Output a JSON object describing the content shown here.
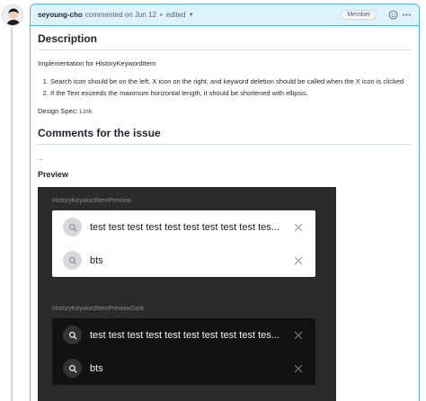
{
  "header": {
    "author": "seyoung-cho",
    "action": "commented on Jun 12",
    "separator": "•",
    "edited": "edited",
    "badge": "Member"
  },
  "description": {
    "title": "Description",
    "intro": "Implementation for HistoryKeywordItem",
    "items": [
      "Search icon should be on the left, X icon on the right, and keyword deletion should be called when the X icon is clicked",
      "If the Text exceeds the maximum horizontal length, it should be shortened with ellipsis."
    ],
    "design_spec_label": "Design Spec:",
    "design_spec_link": "Link"
  },
  "comments": {
    "title": "Comments for the issue",
    "body": "..."
  },
  "preview": {
    "title": "Preview",
    "light_label": "HistoryKeywordItemPreview",
    "dark_label": "HistoryKeywordItemPreviewDark",
    "keywords": [
      "test test test test test test test test test tes...",
      "bts"
    ]
  },
  "colors": {
    "accent": "#0969da",
    "header_bg": "#ddf4ff",
    "header_border": "#54aeff",
    "preview_bg": "#2b2b2b",
    "dark_card": "#121212"
  },
  "icons": {
    "caret": "chevron-down-icon",
    "reaction": "smiley-icon",
    "menu": "kebab-icon",
    "search": "search-icon",
    "close": "close-icon"
  }
}
